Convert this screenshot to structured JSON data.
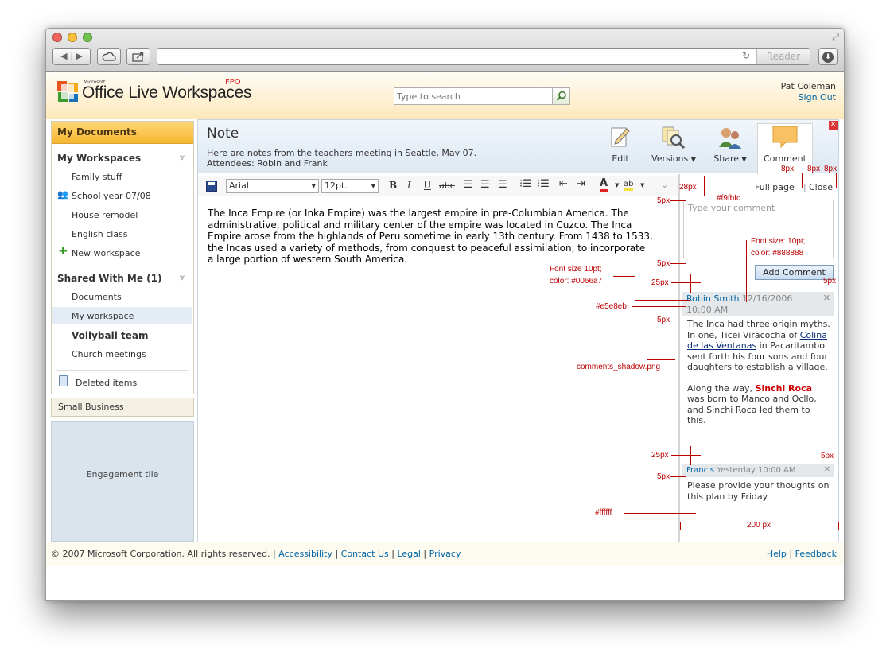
{
  "browser": {
    "address": "",
    "reader_label": "Reader"
  },
  "header": {
    "logo_small": "Microsoft",
    "logo_main": "Office Live Workspaces",
    "fpo": "FPO",
    "search_placeholder": "Type to search",
    "user_name": "Pat Coleman",
    "sign_out": "Sign Out"
  },
  "sidebar": {
    "my_documents": "My Documents",
    "my_workspaces": "My Workspaces",
    "workspace_items": [
      "Family stuff",
      "School year 07/08",
      "House remodel",
      "English class"
    ],
    "new_workspace": "New workspace",
    "shared_title": "Shared With Me (1)",
    "shared_items": [
      "Documents",
      "My workspace",
      "Vollyball team",
      "Church meetings"
    ],
    "deleted_items": "Deleted items",
    "small_business": "Small Business",
    "engagement_tile": "Engagement tile"
  },
  "note": {
    "title": "Note",
    "desc_line1": "Here are notes from the teachers meeting in Seattle, May 07.",
    "desc_line2": "Attendees: Robin and Frank",
    "tools": {
      "edit": "Edit",
      "versions": "Versions",
      "share": "Share",
      "comment": "Comment"
    },
    "font": "Arial",
    "size": "12pt.",
    "body": "The Inca Empire (or Inka Empire) was the largest empire in pre-Columbian America. The administrative, political and military center of the empire was located in Cuzco. The Inca Empire arose from the highlands of Peru sometime in early 13th century. From 1438 to 1533, the Incas used a variety of methods, from conquest to peaceful assimilation, to incorporate a large portion of western South America."
  },
  "comments_panel": {
    "full_page": "Full page",
    "close": "Close",
    "placeholder": "Type your comment",
    "add_button": "Add Comment",
    "comments": [
      {
        "author": "Robin Smith",
        "time_line1": "12/16/2006",
        "time_line2": "10:00 AM",
        "p1_a": "The Inca had three origin myths. In one, Ticei Viracocha of ",
        "p1_link": "Colina de las Ventanas",
        "p1_b": " in Pacaritambo sent forth his four sons and four daughters to establish a village.",
        "p2_a": "Along the way, ",
        "p2_bold": "Sinchi Roca",
        "p2_b": " was born to Manco and Ocllo, and Sinchi Roca led them to this."
      },
      {
        "author": "Francis",
        "time_line1": "Yesterday 10:00 AM",
        "text": "Please provide your thoughts on this plan by Friday."
      }
    ]
  },
  "annotations": {
    "a8_1": "8px",
    "a8_2": "8px",
    "a8_3": "8px",
    "a28": "28px",
    "f9": "#f9fbfc",
    "a5_1": "5px",
    "font10_l1": "Font size: 10pt;",
    "font10_l2": "color: #888888",
    "a5_2": "5px",
    "a25_1": "25px",
    "font_link_l1": "Font size 10pt;",
    "font_link_l2": "color: #0066a7",
    "a5_right": "5px",
    "e5": "#e5e8eb",
    "a5_3": "5px",
    "shadow": "comments_shadow.png",
    "a25_2": "25px",
    "a5_right2": "5px",
    "a5_4": "5px",
    "white": "#ffffff",
    "w200": "200 px"
  },
  "footer": {
    "copyright": "© 2007 Microsoft Corporation. All rights reserved. |",
    "accessibility": "Accessibility",
    "contact": "Contact Us",
    "legal": "Legal",
    "privacy": "Privacy",
    "help": "Help",
    "feedback": "Feedback"
  },
  "colors": {
    "accent": "#f7b630",
    "link": "#0066a7",
    "annotation": "#bb0000",
    "comment_header": "#e5e8eb"
  }
}
